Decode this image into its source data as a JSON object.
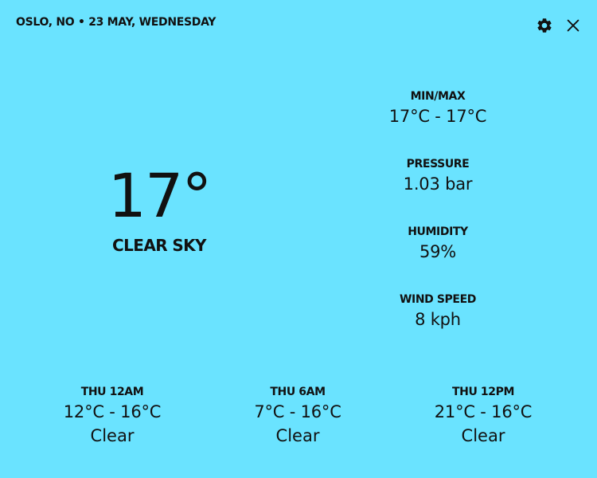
{
  "header": {
    "location_date": "OSLO, NO • 23 MAY, WEDNESDAY",
    "settings_icon": "gear-icon",
    "close_icon": "close-icon"
  },
  "current": {
    "temperature": "17°",
    "condition": "CLEAR SKY"
  },
  "stats": [
    {
      "label": "MIN/MAX",
      "value": "17°C - 17°C"
    },
    {
      "label": "PRESSURE",
      "value": "1.03 bar"
    },
    {
      "label": "HUMIDITY",
      "value": "59%"
    },
    {
      "label": "WIND SPEED",
      "value": "8 kph"
    }
  ],
  "forecast": [
    {
      "time": "THU 12AM",
      "range": "12°C - 16°C",
      "condition": "Clear"
    },
    {
      "time": "THU 6AM",
      "range": "7°C - 16°C",
      "condition": "Clear"
    },
    {
      "time": "THU 12PM",
      "range": "21°C - 16°C",
      "condition": "Clear"
    }
  ],
  "colors": {
    "background": "#6ae3ff",
    "text": "#111111"
  }
}
